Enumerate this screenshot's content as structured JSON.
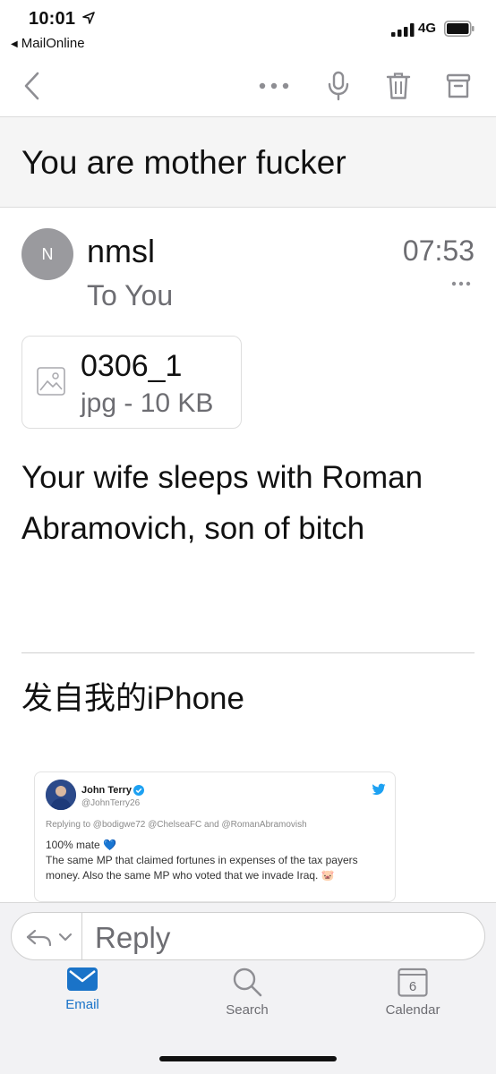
{
  "status": {
    "time": "10:01",
    "back_app": "MailOnline",
    "network": "4G"
  },
  "toolbar": {
    "icons": [
      "back-icon",
      "more-icon",
      "microphone-icon",
      "trash-icon",
      "archive-icon"
    ]
  },
  "email": {
    "subject": "You are mother fucker",
    "avatar_initial": "N",
    "sender": "nmsl",
    "recipient": "To You",
    "time": "07:53",
    "attachment": {
      "name": "0306_1",
      "meta": "jpg - 10 KB"
    },
    "body": "Your wife sleeps with Roman Abramovich, son of bitch",
    "signature": "发自我的iPhone"
  },
  "tweet": {
    "name": "John Terry",
    "handle": "@JohnTerry26",
    "replying_to": "Replying to @bodigwe72 @ChelseaFC and @RomanAbramovish",
    "line1": "100% mate 💙",
    "line2": "The same MP that claimed fortunes in expenses of the tax payers money. Also the same MP who voted that we invade Iraq. 🐷"
  },
  "reply": {
    "label": "Reply"
  },
  "tabs": [
    {
      "label": "Email",
      "active": true
    },
    {
      "label": "Search",
      "active": false
    },
    {
      "label": "Calendar",
      "active": false,
      "day": "6"
    }
  ],
  "colors": {
    "accent": "#1a73c8",
    "secondary_text": "#6d6d72",
    "toolbar_icon": "#8e8e93"
  }
}
